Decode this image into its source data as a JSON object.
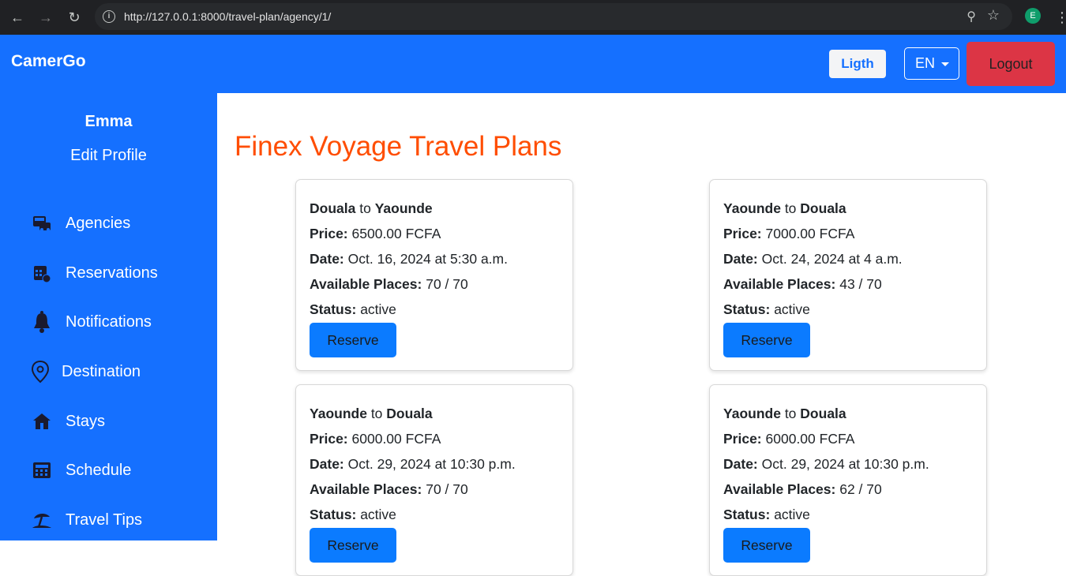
{
  "browser": {
    "url": "http://127.0.0.1:8000/travel-plan/agency/1/",
    "profile_initial": "E"
  },
  "navbar": {
    "brand": "CamerGo",
    "theme_label": "Ligth",
    "language_label": "EN",
    "logout_label": "Logout"
  },
  "sidebar": {
    "user_name": "Emma",
    "edit_profile": "Edit Profile",
    "items": [
      {
        "label": "Agencies",
        "icon": "bus-ticket-icon"
      },
      {
        "label": "Reservations",
        "icon": "calendar-icon"
      },
      {
        "label": "Notifications",
        "icon": "bell-icon"
      },
      {
        "label": "Destination",
        "icon": "location-pin-icon"
      },
      {
        "label": "Stays",
        "icon": "house-icon"
      },
      {
        "label": "Schedule",
        "icon": "calculator-icon"
      },
      {
        "label": "Travel Tips",
        "icon": "beach-icon"
      }
    ]
  },
  "main": {
    "title": "Finex Voyage Travel Plans",
    "labels": {
      "to": "to",
      "price": "Price:",
      "date": "Date:",
      "available": "Available Places:",
      "status": "Status:",
      "reserve": "Reserve"
    },
    "plans": [
      {
        "from": "Douala",
        "to": "Yaounde",
        "price": "6500.00 FCFA",
        "date": "Oct. 16, 2024 at 5:30 a.m.",
        "available": "70 / 70",
        "status": "active"
      },
      {
        "from": "Yaounde",
        "to": "Douala",
        "price": "7000.00 FCFA",
        "date": "Oct. 24, 2024 at 4 a.m.",
        "available": "43 / 70",
        "status": "active"
      },
      {
        "from": "Yaounde",
        "to": "Douala",
        "price": "6000.00 FCFA",
        "date": "Oct. 29, 2024 at 10:30 p.m.",
        "available": "70 / 70",
        "status": "active"
      },
      {
        "from": "Yaounde",
        "to": "Douala",
        "price": "6000.00 FCFA",
        "date": "Oct. 29, 2024 at 10:30 p.m.",
        "available": "62 / 70",
        "status": "active"
      }
    ]
  },
  "colors": {
    "primary": "#1570ff",
    "title": "#ff4d00",
    "logout": "#dc3545",
    "button": "#0b7bff"
  }
}
